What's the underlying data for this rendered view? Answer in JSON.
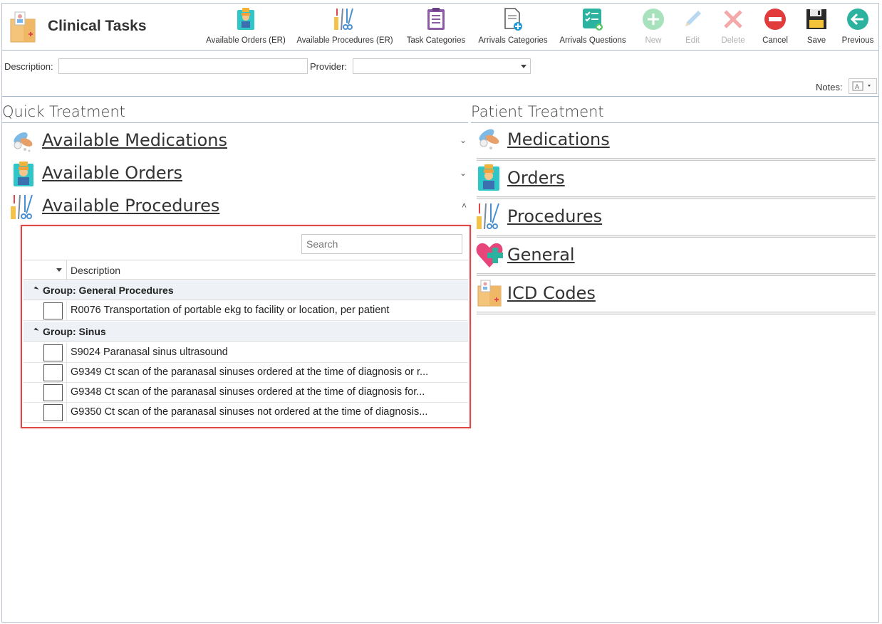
{
  "app": {
    "title": "Clinical Tasks"
  },
  "toolbar": {
    "available_orders_er": "Available Orders (ER)",
    "available_procedures_er": "Available Procedures (ER)",
    "task_categories": "Task Categories",
    "arrivals_categories": "Arrivals Categories",
    "arrivals_questions": "Arrivals Questions",
    "new": "New",
    "edit": "Edit",
    "delete": "Delete",
    "cancel": "Cancel",
    "save": "Save",
    "previous": "Previous"
  },
  "filters": {
    "description_label": "Description:",
    "description_value": "",
    "provider_label": "Provider:",
    "provider_value": "",
    "notes_label": "Notes:"
  },
  "quick_treatment": {
    "title": "Quick Treatment",
    "items": [
      {
        "label": "Available Medications",
        "expanded": false,
        "chevron": "⌄"
      },
      {
        "label": "Available Orders",
        "expanded": false,
        "chevron": "⌄"
      },
      {
        "label": "Available Procedures",
        "expanded": true,
        "chevron": "˄"
      }
    ],
    "grid": {
      "search_placeholder": "Search",
      "column_description": "Description",
      "groups": [
        {
          "label": "Group: General Procedures",
          "rows": [
            {
              "text": "R0076 Transportation of portable ekg to facility or location, per patient",
              "checked": false
            }
          ]
        },
        {
          "label": "Group: Sinus",
          "rows": [
            {
              "text": "S9024 Paranasal sinus ultrasound",
              "checked": false
            },
            {
              "text": "G9349 Ct scan of the paranasal sinuses ordered at the time of diagnosis or r...",
              "checked": false
            },
            {
              "text": "G9348 Ct scan of the paranasal sinuses ordered at the time of diagnosis for...",
              "checked": false
            },
            {
              "text": "G9350 Ct scan of the paranasal sinuses not ordered at the time of diagnosis...",
              "checked": false
            }
          ]
        }
      ]
    }
  },
  "patient_treatment": {
    "title": "Patient Treatment",
    "items": [
      {
        "label": "Medications"
      },
      {
        "label": "Orders"
      },
      {
        "label": "Procedures"
      },
      {
        "label": "General"
      },
      {
        "label": "ICD Codes"
      }
    ]
  },
  "colors": {
    "accent_red": "#e04848",
    "border": "#a8b8c8",
    "disabled_green": "#8fd6a8",
    "teal": "#2bb3a0"
  }
}
